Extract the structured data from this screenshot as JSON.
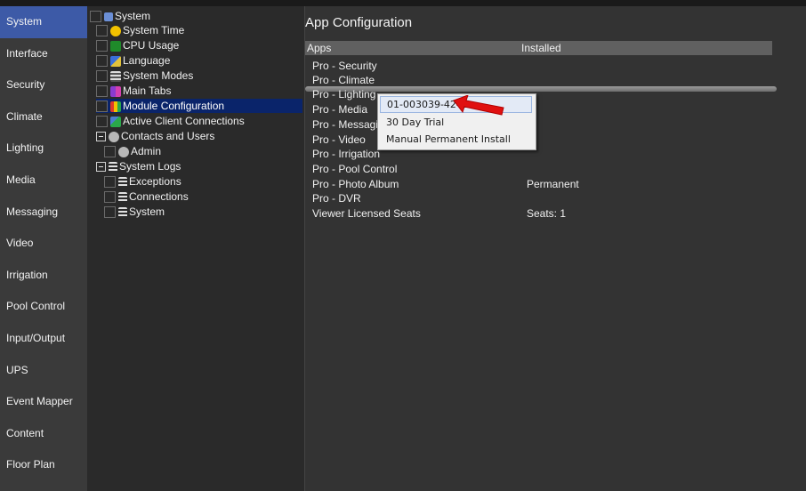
{
  "nav": {
    "items": [
      "System",
      "Interface",
      "Security",
      "Climate",
      "Lighting",
      "Media",
      "Messaging",
      "Video",
      "Irrigation",
      "Pool Control",
      "Input/Output",
      "UPS",
      "Event Mapper",
      "Content",
      "Floor Plan"
    ],
    "active_index": 0
  },
  "tree": {
    "system": "System",
    "system_time": "System Time",
    "cpu_usage": "CPU Usage",
    "language": "Language",
    "system_modes": "System Modes",
    "main_tabs": "Main Tabs",
    "module_configuration": "Module Configuration",
    "active_client_connections": "Active Client Connections",
    "contacts_and_users": "Contacts and Users",
    "admin": "Admin",
    "system_logs": "System Logs",
    "exceptions": "Exceptions",
    "connections": "Connections",
    "logs_system": "System"
  },
  "panel": {
    "title": "App Configuration",
    "col_apps": "Apps",
    "col_installed": "Installed",
    "apps": [
      {
        "name": "Pro - Security",
        "installed": ""
      },
      {
        "name": "Pro - Climate",
        "installed": ""
      },
      {
        "name": "Pro - Lighting",
        "installed": ""
      },
      {
        "name": "Pro - Media",
        "installed": ""
      },
      {
        "name": "Pro - Messaging",
        "installed": ""
      },
      {
        "name": "Pro - Video",
        "installed": ""
      },
      {
        "name": "Pro - Irrigation",
        "installed": ""
      },
      {
        "name": "Pro - Pool Control",
        "installed": ""
      },
      {
        "name": "Pro - Photo Album",
        "installed": "Permanent"
      },
      {
        "name": "Pro - DVR",
        "installed": ""
      },
      {
        "name": "Viewer Licensed Seats",
        "installed": "Seats: 1"
      }
    ]
  },
  "context_menu": {
    "items": [
      "01-003039-4245",
      "30 Day Trial",
      "Manual Permanent Install"
    ]
  },
  "colors": {
    "nav_active": "#3d5aa7",
    "tree_selected": "#0a246a",
    "arrow": "#e01010"
  }
}
